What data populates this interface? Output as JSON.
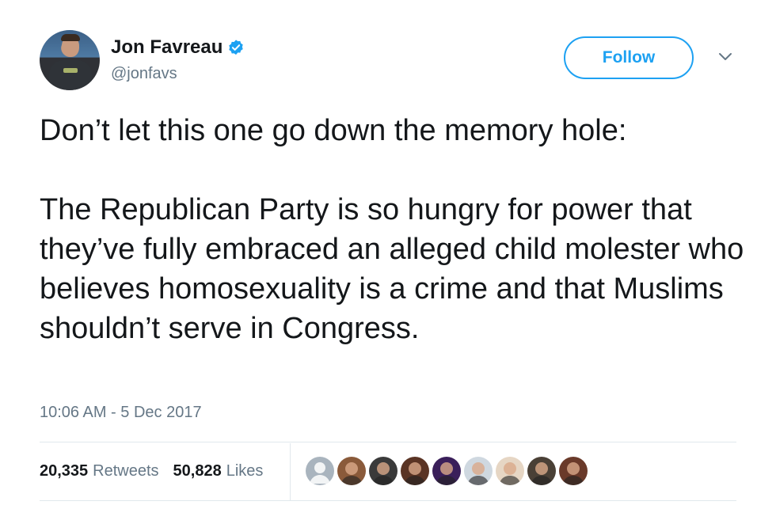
{
  "author": {
    "name": "Jon Favreau",
    "handle": "@jonfavs",
    "verified_icon": "verified-badge-icon"
  },
  "follow_label": "Follow",
  "tweet": {
    "line1": "Don’t let this one go down the memory hole:",
    "paragraph": "The Republican Party is so hungry for power that they’ve fully embraced an alleged child molester who believes homosexuality is a crime and that Muslims shouldn’t serve in Congress."
  },
  "timestamp": "10:06 AM - 5 Dec 2017",
  "stats": {
    "retweets_count": "20,335",
    "retweets_label": "Retweets",
    "likes_count": "50,828",
    "likes_label": "Likes"
  },
  "likers": [
    {
      "name": "default-avatar",
      "color": "#a9b4be"
    },
    {
      "name": "group-photo-avatar",
      "color": "#8a5a3a"
    },
    {
      "name": "person-cap-avatar",
      "color": "#3a3a3a"
    },
    {
      "name": "woman-avatar",
      "color": "#5a3424"
    },
    {
      "name": "purple-avatar",
      "color": "#3a1f5a"
    },
    {
      "name": "cartoon-avatar",
      "color": "#cfd8e0"
    },
    {
      "name": "woman-blonde-avatar",
      "color": "#e6d6c4"
    },
    {
      "name": "couple-avatar",
      "color": "#4a4036"
    },
    {
      "name": "portrait-avatar",
      "color": "#6a3a2a"
    }
  ],
  "colors": {
    "accent": "#1da1f2",
    "text": "#14171a",
    "muted": "#657786",
    "border": "#e1e8ed"
  }
}
